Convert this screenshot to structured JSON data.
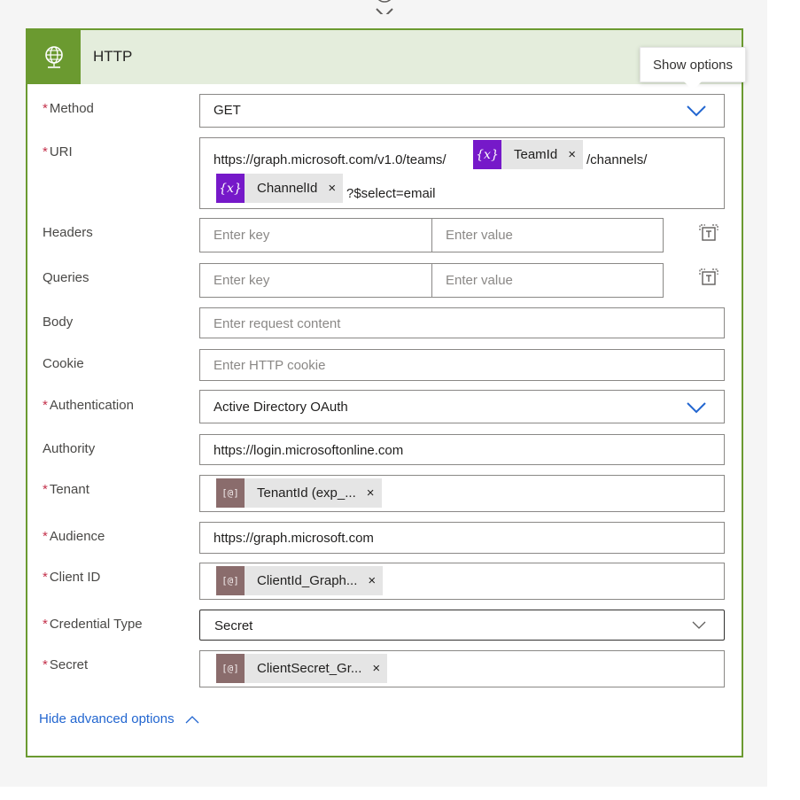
{
  "action": {
    "title": "HTTP",
    "icon": "globe-icon"
  },
  "tooltip": {
    "text": "Show options"
  },
  "fields": {
    "method": {
      "label": "Method",
      "value": "GET"
    },
    "uri": {
      "label": "URI",
      "text_before": "https://graph.microsoft.com/v1.0/teams/",
      "token1": "TeamId",
      "text_middle": "/channels/",
      "token2": "ChannelId",
      "text_after": "?$select=email",
      "token_badge": "{x}"
    },
    "headers": {
      "label": "Headers",
      "key_placeholder": "Enter key",
      "value_placeholder": "Enter value"
    },
    "queries": {
      "label": "Queries",
      "key_placeholder": "Enter key",
      "value_placeholder": "Enter value"
    },
    "body": {
      "label": "Body",
      "placeholder": "Enter request content"
    },
    "cookie": {
      "label": "Cookie",
      "placeholder": "Enter HTTP cookie"
    },
    "authentication": {
      "label": "Authentication",
      "value": "Active Directory OAuth"
    },
    "authority": {
      "label": "Authority",
      "value": "https://login.microsoftonline.com"
    },
    "tenant": {
      "label": "Tenant",
      "token": "TenantId (exp_...",
      "token_badge": "[@]"
    },
    "audience": {
      "label": "Audience",
      "value": "https://graph.microsoft.com"
    },
    "client_id": {
      "label": "Client ID",
      "token": "ClientId_Graph...",
      "token_badge": "[@]"
    },
    "credential_type": {
      "label": "Credential Type",
      "value": "Secret"
    },
    "secret": {
      "label": "Secret",
      "token": "ClientSecret_Gr...",
      "token_badge": "[@]"
    }
  },
  "required_marker": "*",
  "remove_token_glyph": "×",
  "advanced_link": "Hide advanced options",
  "colors": {
    "accent": "#6b9a30",
    "header_bg": "#e4eddc",
    "variable_token": "#7619c9",
    "parameter_token": "#8a6c6c",
    "link": "#2266d0",
    "required": "#c4314b"
  }
}
